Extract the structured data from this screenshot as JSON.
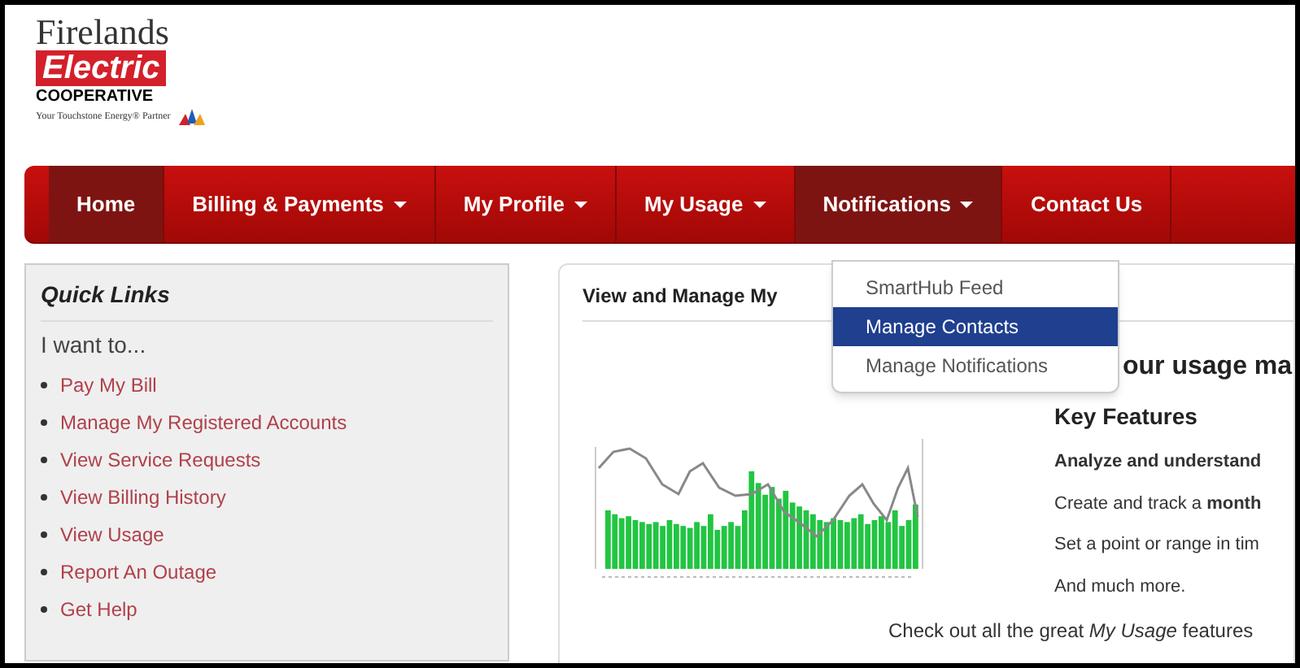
{
  "logo": {
    "name_top": "Firelands",
    "name_badge": "Electric",
    "name_bottom": "COOPERATIVE",
    "tagline": "Your Touchstone Energy® Partner"
  },
  "nav": [
    {
      "label": "Home",
      "dropdown": false,
      "selected": true
    },
    {
      "label": "Billing & Payments",
      "dropdown": true,
      "selected": false
    },
    {
      "label": "My Profile",
      "dropdown": true,
      "selected": false
    },
    {
      "label": "My Usage",
      "dropdown": true,
      "selected": false
    },
    {
      "label": "Notifications",
      "dropdown": true,
      "selected": true
    },
    {
      "label": "Contact Us",
      "dropdown": false,
      "selected": false
    }
  ],
  "dropdown_menu": [
    {
      "label": "SmartHub Feed",
      "selected": false
    },
    {
      "label": "Manage Contacts",
      "selected": true
    },
    {
      "label": "Manage Notifications",
      "selected": false
    }
  ],
  "quick_links": {
    "title": "Quick Links",
    "intro": "I want to...",
    "links": [
      "Pay My Bill",
      "Manage My Registered Accounts",
      "View Service Requests",
      "View Billing History",
      "View Usage",
      "Report An Outage",
      "Get Help"
    ]
  },
  "main_panel": {
    "title": "View and Manage My",
    "heading": "our usage ma",
    "subheading": "Key Features",
    "features": [
      "**Analyze and understand**",
      "Create and track a **month**",
      "Set a point or range in tim",
      "And much more."
    ],
    "footer": "Check out all the great *My Usage* features"
  }
}
